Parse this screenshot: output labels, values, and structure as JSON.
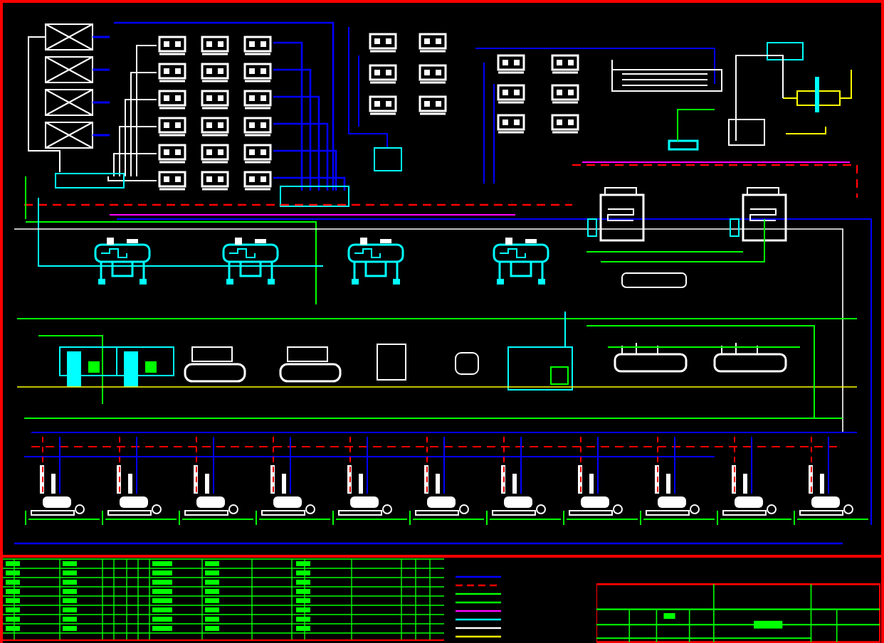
{
  "legend": [
    {
      "color": "#0000ff",
      "kind": "solid"
    },
    {
      "color": "#ff0000",
      "kind": "dashed"
    },
    {
      "color": "#00ff00",
      "kind": "solid"
    },
    {
      "color": "#00ff00",
      "kind": "solid"
    },
    {
      "color": "#ff00ff",
      "kind": "solid"
    },
    {
      "color": "#00ffff",
      "kind": "solid"
    },
    {
      "color": "#ffffff",
      "kind": "solid"
    },
    {
      "color": "#ffff00",
      "kind": "solid"
    }
  ]
}
